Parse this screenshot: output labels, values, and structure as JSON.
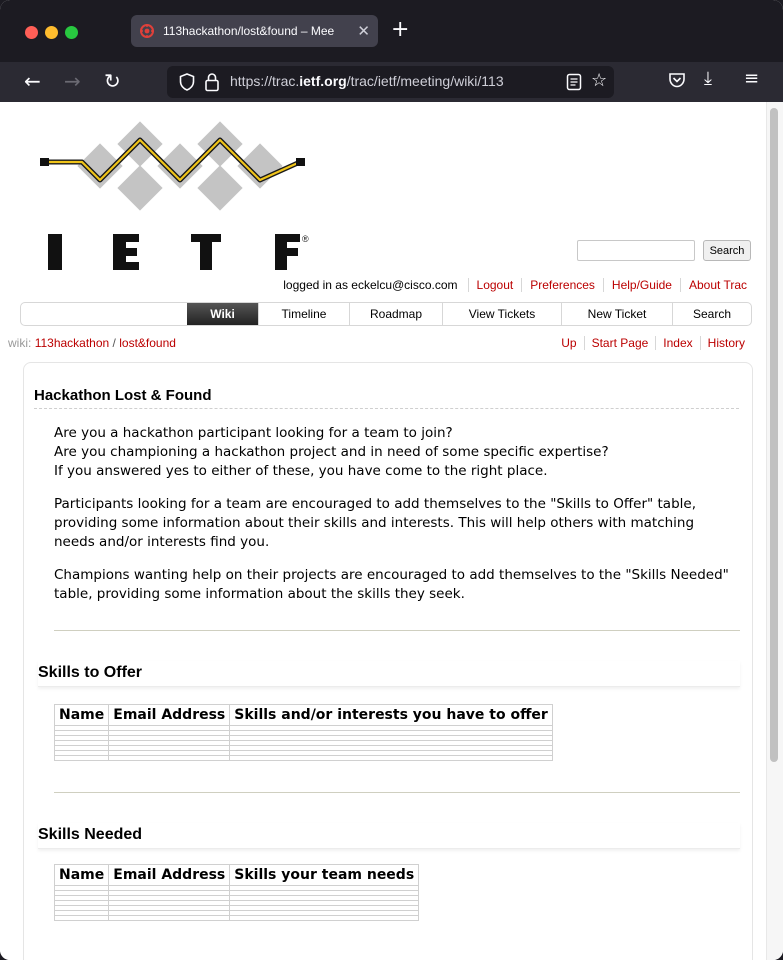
{
  "browser": {
    "tab_title": "113hackathon/lost&found – Mee",
    "url_prefix": "https://trac.",
    "url_domain": "ietf.org",
    "url_suffix": "/trac/ietf/meeting/wiki/113"
  },
  "site": {
    "logo_text": "IETF",
    "search_button": "Search",
    "search_placeholder": ""
  },
  "metanav": {
    "logged_in": "logged in as eckelcu@cisco.com",
    "items": [
      "Logout",
      "Preferences",
      "Help/Guide",
      "About Trac"
    ]
  },
  "mainnav": [
    "Wiki",
    "Timeline",
    "Roadmap",
    "View Tickets",
    "New Ticket",
    "Search"
  ],
  "ctxtnav": {
    "prefix": "wiki:",
    "crumb1": "113hackathon",
    "sep": "/",
    "crumb2": "lost&found",
    "items": [
      "Up",
      "Start Page",
      "Index",
      "History"
    ]
  },
  "content": {
    "title": "Hackathon Lost & Found",
    "intro_lines": [
      "Are you a hackathon participant looking for a team to join?",
      "Are you championing a hackathon project and in need of some specific expertise?",
      "If you answered yes to either of these, you have come to the right place."
    ],
    "para2": "Participants looking for a team are encouraged to add themselves to the \"Skills to Offer\" table, providing some information about their skills and interests. This will help others with matching needs and/or interests find you.",
    "para3": "Champions wanting help on their projects are encouraged to add themselves to the \"Skills Needed\" table, providing some information about the skills they seek.",
    "offer": {
      "heading": "Skills to Offer",
      "columns": [
        "Name",
        "Email Address",
        "Skills and/or interests you have to offer"
      ]
    },
    "needed": {
      "heading": "Skills Needed",
      "columns": [
        "Name",
        "Email Address",
        "Skills your team needs"
      ]
    }
  }
}
